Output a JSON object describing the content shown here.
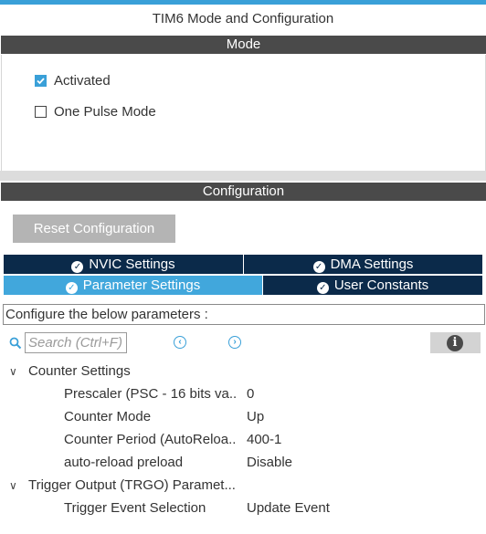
{
  "window": {
    "title": "TIM6 Mode and Configuration"
  },
  "mode": {
    "header": "Mode",
    "options": [
      {
        "label": "Activated",
        "checked": true
      },
      {
        "label": "One Pulse Mode",
        "checked": false
      }
    ]
  },
  "configuration": {
    "header": "Configuration",
    "reset_label": "Reset Configuration",
    "tabs": [
      {
        "label": "NVIC Settings",
        "active": false
      },
      {
        "label": "DMA Settings",
        "active": false
      },
      {
        "label": "Parameter Settings",
        "active": true
      },
      {
        "label": "User Constants",
        "active": false
      }
    ],
    "description": "Configure the below parameters :",
    "search_placeholder": "Search (Ctrl+F)",
    "groups": [
      {
        "name": "Counter Settings",
        "params": [
          {
            "name": "Prescaler (PSC - 16 bits va..",
            "value": "0"
          },
          {
            "name": "Counter Mode",
            "value": "Up"
          },
          {
            "name": "Counter Period (AutoReloa..",
            "value": "400-1"
          },
          {
            "name": "auto-reload preload",
            "value": "Disable"
          }
        ]
      },
      {
        "name": "Trigger Output (TRGO) Paramet...",
        "params": [
          {
            "name": "Trigger Event Selection",
            "value": "Update Event"
          }
        ]
      }
    ]
  }
}
